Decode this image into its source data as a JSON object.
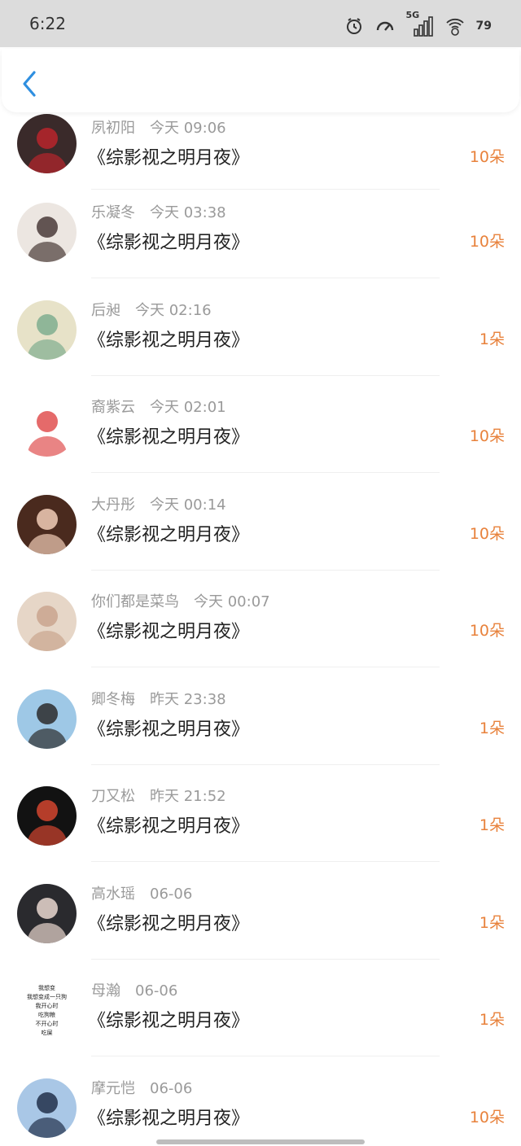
{
  "status_bar": {
    "time": "6:22",
    "network": "5G",
    "battery": "79"
  },
  "rows": [
    {
      "name": "夙初阳",
      "time": "今天 09:06",
      "title": "《综影视之明月夜》",
      "count": "10朵",
      "avatar_bg": "#3a2a2a",
      "avatar_fg": "#b8252c"
    },
    {
      "name": "乐凝冬",
      "time": "今天 03:38",
      "title": "《综影视之明月夜》",
      "count": "10朵",
      "avatar_bg": "#ece6e1",
      "avatar_fg": "#4a3a38"
    },
    {
      "name": "后昶",
      "time": "今天 02:16",
      "title": "《综影视之明月夜》",
      "count": "1朵",
      "avatar_bg": "#e7e2c8",
      "avatar_fg": "#7fae8f"
    },
    {
      "name": "裔紫云",
      "time": "今天 02:01",
      "title": "《综影视之明月夜》",
      "count": "10朵",
      "avatar_bg": "#ffffff",
      "avatar_fg": "#e05050"
    },
    {
      "name": "大丹彤",
      "time": "今天 00:14",
      "title": "《综影视之明月夜》",
      "count": "10朵",
      "avatar_bg": "#4a2a1e",
      "avatar_fg": "#f1cdb7"
    },
    {
      "name": "你们都是菜鸟",
      "time": "今天 00:07",
      "title": "《综影视之明月夜》",
      "count": "10朵",
      "avatar_bg": "#e6d6c7",
      "avatar_fg": "#c9a58e"
    },
    {
      "name": "卿冬梅",
      "time": "昨天 23:38",
      "title": "《综影视之明月夜》",
      "count": "1朵",
      "avatar_bg": "#9ec8e6",
      "avatar_fg": "#2c2c2c"
    },
    {
      "name": "刀又松",
      "time": "昨天 21:52",
      "title": "《综影视之明月夜》",
      "count": "1朵",
      "avatar_bg": "#121212",
      "avatar_fg": "#d2452f"
    },
    {
      "name": "高水瑶",
      "time": "06-06",
      "title": "《综影视之明月夜》",
      "count": "1朵",
      "avatar_bg": "#2a2a2e",
      "avatar_fg": "#e9d7cf"
    },
    {
      "name": "母瀚",
      "time": "06-06",
      "title": "《综影视之明月夜》",
      "count": "1朵",
      "avatar_bg": "#ffffff",
      "avatar_fg": "#222222",
      "avatar_text": [
        "我想变",
        "我想变成一只狗",
        "我开心时",
        "吃狗粮",
        "不开心时",
        "吃屎"
      ]
    },
    {
      "name": "摩元恺",
      "time": "06-06",
      "title": "《综影视之明月夜》",
      "count": "10朵",
      "avatar_bg": "#a9c7e6",
      "avatar_fg": "#22304a"
    }
  ],
  "colors": {
    "accent": "#2f8fe0",
    "count": "#e8823c",
    "meta": "#9a9a9a"
  }
}
